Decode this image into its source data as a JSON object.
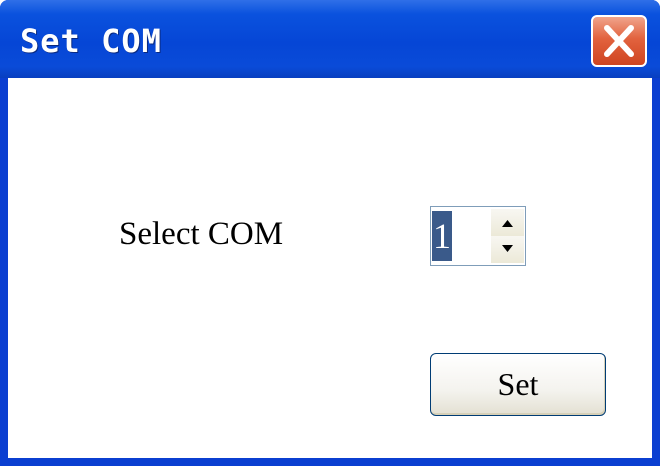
{
  "window": {
    "title": "Set COM"
  },
  "form": {
    "label": "Select COM",
    "com_value": "1"
  },
  "buttons": {
    "set_label": "Set"
  },
  "icons": {
    "close": "close-icon",
    "spin_up": "arrow-up-icon",
    "spin_down": "arrow-down-icon"
  },
  "colors": {
    "titlebar": "#0a52de",
    "close_button": "#e2623e",
    "selection": "#3a5a8a"
  }
}
